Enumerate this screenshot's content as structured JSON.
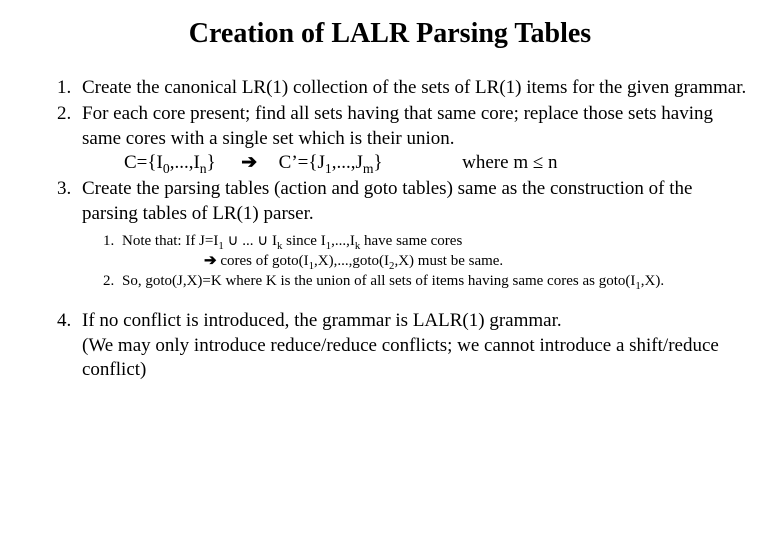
{
  "title": "Creation of LALR Parsing Tables",
  "items": {
    "i1": "Create the canonical LR(1) collection of the sets of LR(1) items for the given grammar.",
    "i2": "For each core present; find all sets having that same core; replace those sets having same cores with a single set which is their union.",
    "i2_c_pre": "C={I",
    "i2_c_mid": ",...,I",
    "i2_c_close": "}",
    "i2_arrow": "➔",
    "i2_cp_pre": "C’={J",
    "i2_cp_mid": ",...,J",
    "i2_cp_close": "}",
    "i2_where": "where m ≤ n",
    "i3": "Create the parsing tables (action and goto tables) same as the construction of the parsing tables of LR(1) parser.",
    "sub1a": "Note that:  If  J=I",
    "sub1b": " ∪ ... ∪ I",
    "sub1c": "  since I",
    "sub1d": ",...,I",
    "sub1e": " have same cores",
    "sub2_arrow": "➔",
    "sub2a": " cores of goto(I",
    "sub2b": ",X),...,goto(I",
    "sub2c": ",X) must be same.",
    "sub3a": "So, goto(J,X)=K  where K is the union of all sets of items having same cores as goto(I",
    "sub3b": ",X).",
    "i4a": "If no conflict is introduced, the grammar is LALR(1) grammar.",
    "i4b": "(We may only introduce reduce/reduce conflicts; we cannot introduce a shift/reduce conflict)"
  },
  "idx": {
    "zero": "0",
    "one": "1",
    "two": "2",
    "n": "n",
    "m": "m",
    "k": "k"
  }
}
